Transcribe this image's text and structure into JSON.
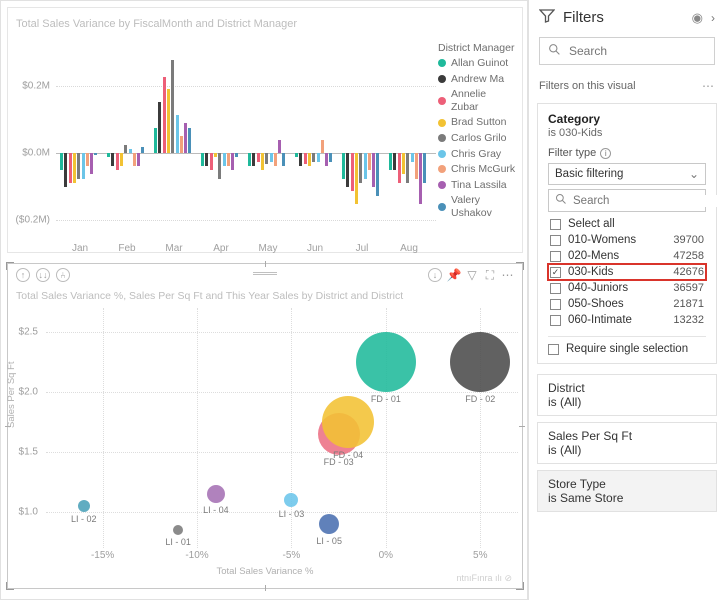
{
  "top": {
    "title": "Total Sales Variance by FiscalMonth and District Manager",
    "y_labels": [
      "$0.2M",
      "$0.0M",
      "($0.2M)"
    ],
    "months": [
      "Jan",
      "Feb",
      "Mar",
      "Apr",
      "May",
      "Jun",
      "Jul",
      "Aug"
    ],
    "legend_title": "District Manager",
    "legend": [
      {
        "name": "Allan Guinot",
        "color": "#1fb99b"
      },
      {
        "name": "Andrew Ma",
        "color": "#3b3b3b"
      },
      {
        "name": "Annelie Zubar",
        "color": "#ed5f78"
      },
      {
        "name": "Brad Sutton",
        "color": "#f2c233"
      },
      {
        "name": "Carlos Grilo",
        "color": "#7b7b7b"
      },
      {
        "name": "Chris Gray",
        "color": "#6bc5e8"
      },
      {
        "name": "Chris McGurk",
        "color": "#f2a17b"
      },
      {
        "name": "Tina Lassila",
        "color": "#a65fb0"
      },
      {
        "name": "Valery Ushakov",
        "color": "#4a90b8"
      }
    ]
  },
  "bot": {
    "title": "Total Sales Variance %, Sales Per Sq Ft and This Year Sales by District and District",
    "y_title": "Sales Per Sq Ft",
    "x_title": "Total Sales Variance %",
    "y_labels": [
      "$2.5",
      "$2.0",
      "$1.5",
      "$1.0"
    ],
    "x_labels": [
      "-15%",
      "-10%",
      "-5%",
      "0%",
      "5%"
    ],
    "bubble_labels": {
      "li01": "LI - 01",
      "li02": "LI - 02",
      "li03": "LI - 03",
      "li04": "LI - 04",
      "li05": "LI - 05",
      "fd01": "FD - 01",
      "fd02": "FD - 02",
      "fd03": "FD - 03",
      "fd04": "FD - 04"
    },
    "stamp": "ntnıFınra ılı ⊘"
  },
  "filters": {
    "header": "Filters",
    "search_placeholder": "Search",
    "scope": "Filters on this visual",
    "category": {
      "name": "Category",
      "sub": "is 030-Kids",
      "filter_type_label": "Filter type",
      "filter_type_value": "Basic filtering",
      "search_placeholder": "Search",
      "require_single": "Require single selection",
      "options": [
        {
          "label": "Select all",
          "count": "",
          "checked": false
        },
        {
          "label": "010-Womens",
          "count": "39700",
          "checked": false
        },
        {
          "label": "020-Mens",
          "count": "47258",
          "checked": false
        },
        {
          "label": "030-Kids",
          "count": "42676",
          "checked": true,
          "hl": true
        },
        {
          "label": "040-Juniors",
          "count": "36597",
          "checked": false
        },
        {
          "label": "050-Shoes",
          "count": "21871",
          "checked": false
        },
        {
          "label": "060-Intimate",
          "count": "13232",
          "checked": false
        }
      ]
    },
    "card_district": {
      "name": "District",
      "sub": "is (All)"
    },
    "card_spsf": {
      "name": "Sales Per Sq Ft",
      "sub": "is (All)"
    },
    "card_store": {
      "name": "Store Type",
      "sub": "is Same Store"
    }
  },
  "chart_data": [
    {
      "type": "bar",
      "title": "Total Sales Variance by FiscalMonth and District Manager",
      "xlabel": "FiscalMonth",
      "ylabel": "Total Sales Variance",
      "ylim": [
        -200000,
        200000
      ],
      "categories": [
        "Jan",
        "Feb",
        "Mar",
        "Apr",
        "May",
        "Jun",
        "Jul",
        "Aug"
      ],
      "series": [
        {
          "name": "Allan Guinot",
          "color": "#1fb99b",
          "values": [
            -40000,
            -10000,
            60000,
            -30000,
            -30000,
            -10000,
            -60000,
            -40000
          ]
        },
        {
          "name": "Andrew Ma",
          "color": "#3b3b3b",
          "values": [
            -80000,
            -30000,
            120000,
            -30000,
            -30000,
            -30000,
            -80000,
            -40000
          ]
        },
        {
          "name": "Annelie Zubar",
          "color": "#ed5f78",
          "values": [
            -70000,
            -40000,
            180000,
            -40000,
            -20000,
            -25000,
            -90000,
            -70000
          ]
        },
        {
          "name": "Brad Sutton",
          "color": "#f2c233",
          "values": [
            -70000,
            -30000,
            150000,
            -10000,
            -40000,
            -30000,
            -120000,
            -50000
          ]
        },
        {
          "name": "Carlos Grilo",
          "color": "#7b7b7b",
          "values": [
            -60000,
            20000,
            220000,
            -60000,
            -25000,
            -20000,
            -70000,
            -70000
          ]
        },
        {
          "name": "Chris Gray",
          "color": "#6bc5e8",
          "values": [
            -60000,
            10000,
            90000,
            -30000,
            -20000,
            -20000,
            -60000,
            -20000
          ]
        },
        {
          "name": "Chris McGurk",
          "color": "#f2a17b",
          "values": [
            -30000,
            -30000,
            40000,
            -30000,
            -30000,
            30000,
            -40000,
            -60000
          ]
        },
        {
          "name": "Tina Lassila",
          "color": "#a65fb0",
          "values": [
            -50000,
            -30000,
            70000,
            -40000,
            30000,
            -30000,
            -80000,
            -120000
          ]
        },
        {
          "name": "Valery Ushakov",
          "color": "#4a90b8",
          "values": [
            -5000,
            15000,
            60000,
            -10000,
            -30000,
            -20000,
            -100000,
            -70000
          ]
        }
      ]
    },
    {
      "type": "scatter",
      "title": "Total Sales Variance %, Sales Per Sq Ft and This Year Sales by District and District",
      "xlabel": "Total Sales Variance %",
      "ylabel": "Sales Per Sq Ft",
      "xlim": [
        -18,
        7
      ],
      "ylim": [
        0.7,
        2.7
      ],
      "points": [
        {
          "id": "LI - 01",
          "x": -11,
          "y": 0.85,
          "size": 10,
          "color": "#7b7b7b"
        },
        {
          "id": "LI - 02",
          "x": -16,
          "y": 1.05,
          "size": 12,
          "color": "#4aa0b8"
        },
        {
          "id": "LI - 03",
          "x": -5,
          "y": 1.1,
          "size": 14,
          "color": "#6bc5ea"
        },
        {
          "id": "LI - 04",
          "x": -9,
          "y": 1.15,
          "size": 18,
          "color": "#a571b4"
        },
        {
          "id": "LI - 05",
          "x": -3,
          "y": 0.9,
          "size": 20,
          "color": "#4a6fb0"
        },
        {
          "id": "FD - 03",
          "x": -2.5,
          "y": 1.65,
          "size": 42,
          "color": "#ec6f84"
        },
        {
          "id": "FD - 04",
          "x": -2,
          "y": 1.75,
          "size": 52,
          "color": "#f2c233"
        },
        {
          "id": "FD - 01",
          "x": 0,
          "y": 2.25,
          "size": 60,
          "color": "#1fb99b"
        },
        {
          "id": "FD - 02",
          "x": 5,
          "y": 2.25,
          "size": 60,
          "color": "#4b4b4b"
        }
      ]
    }
  ]
}
